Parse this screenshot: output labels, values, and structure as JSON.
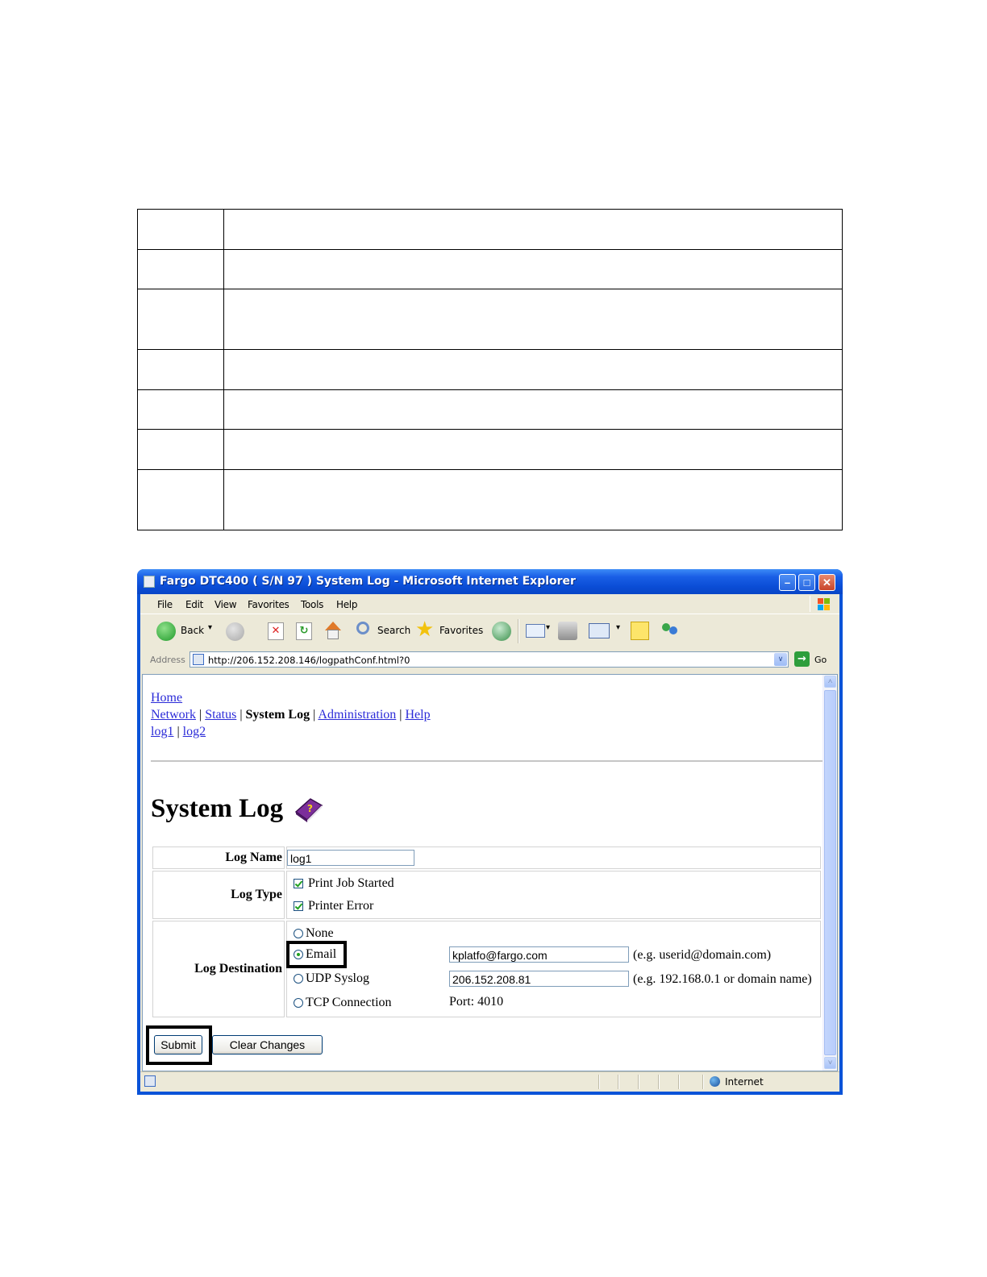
{
  "window": {
    "title": "Fargo DTC400 ( S/N 97 ) System Log - Microsoft Internet Explorer",
    "min_symbol": "–",
    "max_symbol": "□",
    "close_symbol": "✕"
  },
  "menubar": {
    "items": [
      {
        "key": "F",
        "rest": "ile"
      },
      {
        "key": "E",
        "rest": "dit"
      },
      {
        "key": "V",
        "rest": "iew"
      },
      {
        "key": "F",
        "rest": "avorites",
        "prefix": ""
      },
      {
        "key": "T",
        "rest": "ools"
      },
      {
        "key": "H",
        "rest": "elp"
      }
    ],
    "labels": [
      "File",
      "Edit",
      "View",
      "Favorites",
      "Tools",
      "Help"
    ]
  },
  "toolbar": {
    "back_label": "Back",
    "search_label": "Search",
    "favorites_label": "Favorites",
    "dropdown_symbol": "▾"
  },
  "address": {
    "label": "Address",
    "url": "http://206.152.208.146/logpathConf.html?0",
    "go_label": "Go",
    "go_symbol": "→",
    "drop_symbol": "∨"
  },
  "nav": {
    "home": "Home",
    "network": "Network",
    "status": "Status",
    "current": "System Log",
    "administration": "Administration",
    "help": "Help",
    "log1": "log1",
    "log2": "log2",
    "sep": " | "
  },
  "page": {
    "title": "System Log"
  },
  "form": {
    "log_name_label": "Log Name",
    "log_name_value": "log1",
    "log_type_label": "Log Type",
    "log_types": [
      {
        "label": "Print Job Started",
        "checked": true
      },
      {
        "label": "Printer Error",
        "checked": true
      }
    ],
    "log_destination_label": "Log Destination",
    "destinations": {
      "none": "None",
      "email": "Email",
      "udp": "UDP Syslog",
      "tcp": "TCP Connection",
      "selected": "Email"
    },
    "email_value": "kplatfo@fargo.com",
    "email_hint": "(e.g. userid@domain.com)",
    "udp_value": "206.152.208.81",
    "udp_hint": "(e.g. 192.168.0.1 or domain name)",
    "tcp_port": "Port: 4010"
  },
  "buttons": {
    "submit": "Submit",
    "clear": "Clear Changes"
  },
  "statusbar": {
    "zone": "Internet"
  },
  "scrollbar": {
    "up": "˄",
    "down": "˅"
  }
}
